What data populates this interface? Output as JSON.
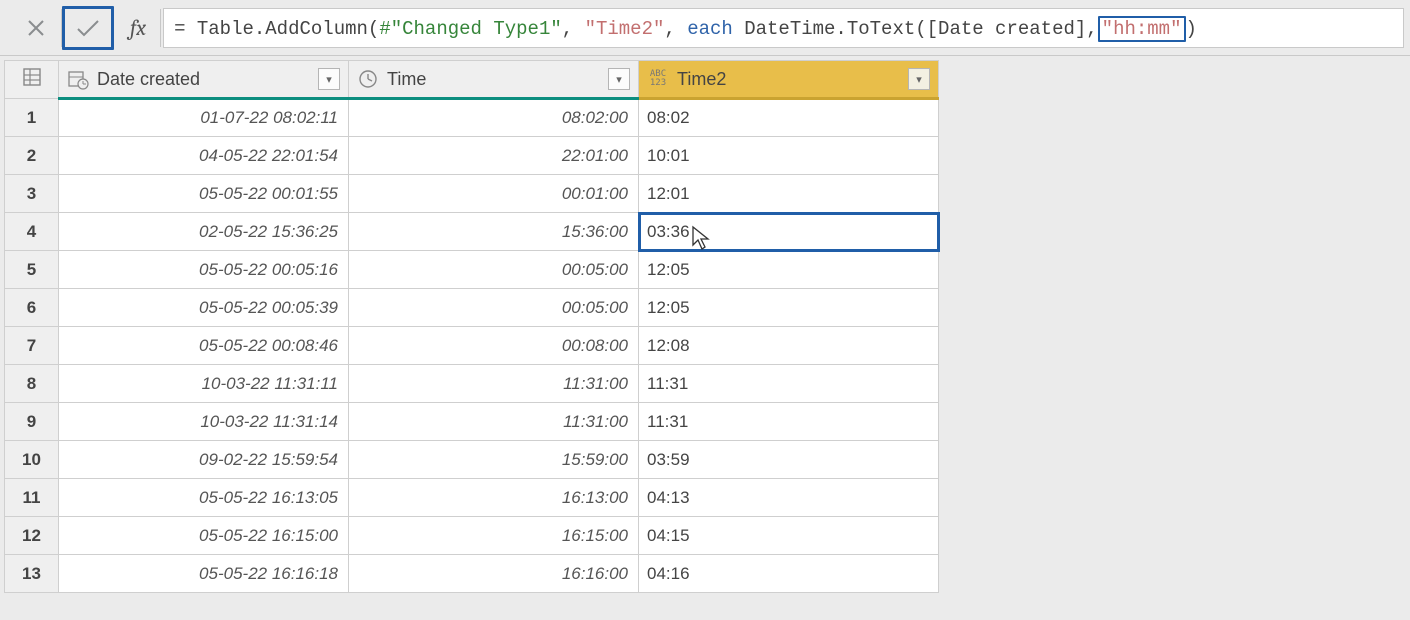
{
  "formula": {
    "eq": "=",
    "part1": " Table.AddColumn(",
    "hashstr": "#\"Changed Type1\"",
    "comma1": ", ",
    "newcol": "\"Time2\"",
    "comma2": ", ",
    "each_kw": "each",
    "part2": " DateTime.ToText([Date created],",
    "format": "\"hh:mm\"",
    "part3": ")"
  },
  "fx_label": "fx",
  "columns": {
    "date": {
      "label": "Date created"
    },
    "time": {
      "label": "Time"
    },
    "time2": {
      "label": "Time2",
      "type_badge": "ABC\n123"
    }
  },
  "rows": [
    {
      "n": "1",
      "date": "01-07-22 08:02:11",
      "time": "08:02:00",
      "time2": "08:02"
    },
    {
      "n": "2",
      "date": "04-05-22 22:01:54",
      "time": "22:01:00",
      "time2": "10:01"
    },
    {
      "n": "3",
      "date": "05-05-22 00:01:55",
      "time": "00:01:00",
      "time2": "12:01"
    },
    {
      "n": "4",
      "date": "02-05-22 15:36:25",
      "time": "15:36:00",
      "time2": "03:36"
    },
    {
      "n": "5",
      "date": "05-05-22 00:05:16",
      "time": "00:05:00",
      "time2": "12:05"
    },
    {
      "n": "6",
      "date": "05-05-22 00:05:39",
      "time": "00:05:00",
      "time2": "12:05"
    },
    {
      "n": "7",
      "date": "05-05-22 00:08:46",
      "time": "00:08:00",
      "time2": "12:08"
    },
    {
      "n": "8",
      "date": "10-03-22 11:31:11",
      "time": "11:31:00",
      "time2": "11:31"
    },
    {
      "n": "9",
      "date": "10-03-22 11:31:14",
      "time": "11:31:00",
      "time2": "11:31"
    },
    {
      "n": "10",
      "date": "09-02-22 15:59:54",
      "time": "15:59:00",
      "time2": "03:59"
    },
    {
      "n": "11",
      "date": "05-05-22 16:13:05",
      "time": "16:13:00",
      "time2": "04:13"
    },
    {
      "n": "12",
      "date": "05-05-22 16:15:00",
      "time": "16:15:00",
      "time2": "04:15"
    },
    {
      "n": "13",
      "date": "05-05-22 16:16:18",
      "time": "16:16:00",
      "time2": "04:16"
    }
  ],
  "selected_row_index": 3
}
